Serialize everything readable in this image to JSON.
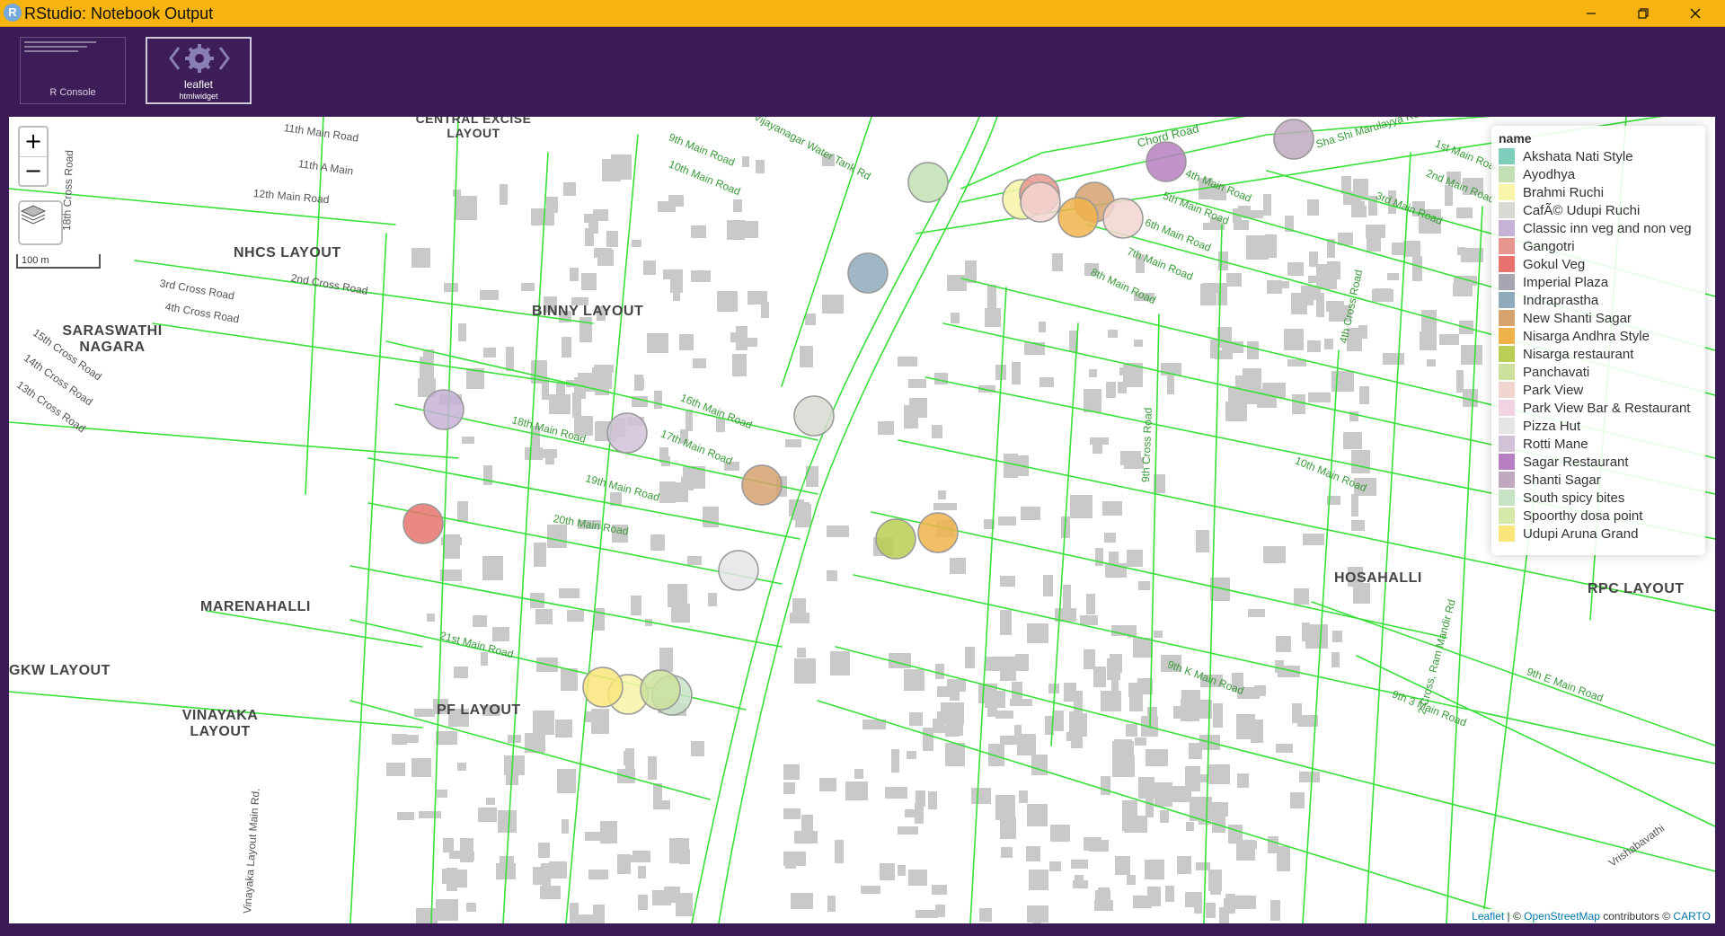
{
  "window": {
    "title": "RStudio: Notebook Output",
    "icon_letter": "R"
  },
  "thumbnails": [
    {
      "label": "R Console",
      "sublabel": ""
    },
    {
      "label": "leaflet",
      "sublabel": "htmlwidget"
    }
  ],
  "map": {
    "zoom_in": "+",
    "zoom_out": "−",
    "scale_label": "100 m",
    "legend": {
      "title": "name",
      "items": [
        {
          "name": "Akshata Nati Style",
          "color": "#7fcdbb"
        },
        {
          "name": "Ayodhya",
          "color": "#c2e0b4"
        },
        {
          "name": "Brahmi Ruchi",
          "color": "#f8f5a8"
        },
        {
          "name": "CafÃ© Udupi Ruchi",
          "color": "#d9d9d3"
        },
        {
          "name": "Classic inn veg and non veg",
          "color": "#c5b2d6"
        },
        {
          "name": "Gangotri",
          "color": "#e7968f"
        },
        {
          "name": "Gokul Veg",
          "color": "#e8736e"
        },
        {
          "name": "Imperial Plaza",
          "color": "#a9a4b2"
        },
        {
          "name": "Indraprastha",
          "color": "#8eaabb"
        },
        {
          "name": "New Shanti Sagar",
          "color": "#d6a26e"
        },
        {
          "name": "Nisarga Andhra Style",
          "color": "#f0b34b"
        },
        {
          "name": "Nisarga restaurant",
          "color": "#b8cf54"
        },
        {
          "name": "Panchavati",
          "color": "#cde09e"
        },
        {
          "name": "Park View",
          "color": "#f3d5d0"
        },
        {
          "name": "Park View Bar & Restaurant",
          "color": "#f2d3e2"
        },
        {
          "name": "Pizza Hut",
          "color": "#e6e4e6"
        },
        {
          "name": "Rotti Mane",
          "color": "#d1c2d8"
        },
        {
          "name": "Sagar Restaurant",
          "color": "#b77fc1"
        },
        {
          "name": "Shanti Sagar",
          "color": "#c0a9be"
        },
        {
          "name": "South spicy bites",
          "color": "#c8e2c5"
        },
        {
          "name": "Spoorthy dosa point",
          "color": "#d6e8a8"
        },
        {
          "name": "Udupi Aruna Grand",
          "color": "#f9e57a"
        }
      ]
    },
    "places": [
      "NHCS LAYOUT",
      "SARASWATHI NAGARA",
      "BINNY LAYOUT",
      "MARENAHALLI",
      "GKW LAYOUT",
      "VINAYAKA LAYOUT",
      "PF LAYOUT",
      "HOSAHALLI",
      "RPC LAYOUT",
      "CENTRAL EXCISE LAYOUT"
    ],
    "roads": [
      "11th Main Road",
      "11th A Main",
      "12th Main Road",
      "2nd Cross Road",
      "3rd Cross Road",
      "4th Cross Road",
      "15th Cross Road",
      "14th Cross Road",
      "13th Cross Road",
      "18th Cross Road",
      "9th Main Road",
      "10th Main Road",
      "Vijayanagar Water Tank Rd",
      "Chord Road",
      "Sha Shi Marulayya Rd.",
      "4th Main Road",
      "5th Main Road",
      "6th Main Road",
      "7th Main Road",
      "8th Main Road",
      "1st Main Road",
      "2nd Main Road",
      "3rd Main Road",
      "9th Cross Road",
      "4th Cross Road",
      "16th Main Road",
      "17th Main Road",
      "18th Main Road",
      "19th Main Road",
      "20th Main Road",
      "21st Main Road",
      "10th Main Road",
      "9th K Main Road",
      "9th E Main Road",
      "9th 3 Main Road",
      "Vrishabavathi",
      "2 Cross, Ram Mandir Rd",
      "Vinayaka Layout Main Rd."
    ],
    "attribution": {
      "leaflet": "Leaflet",
      "sep": " | © ",
      "osm": "OpenStreetMap",
      "contrib": " contributors © ",
      "carto": "CARTO"
    }
  }
}
